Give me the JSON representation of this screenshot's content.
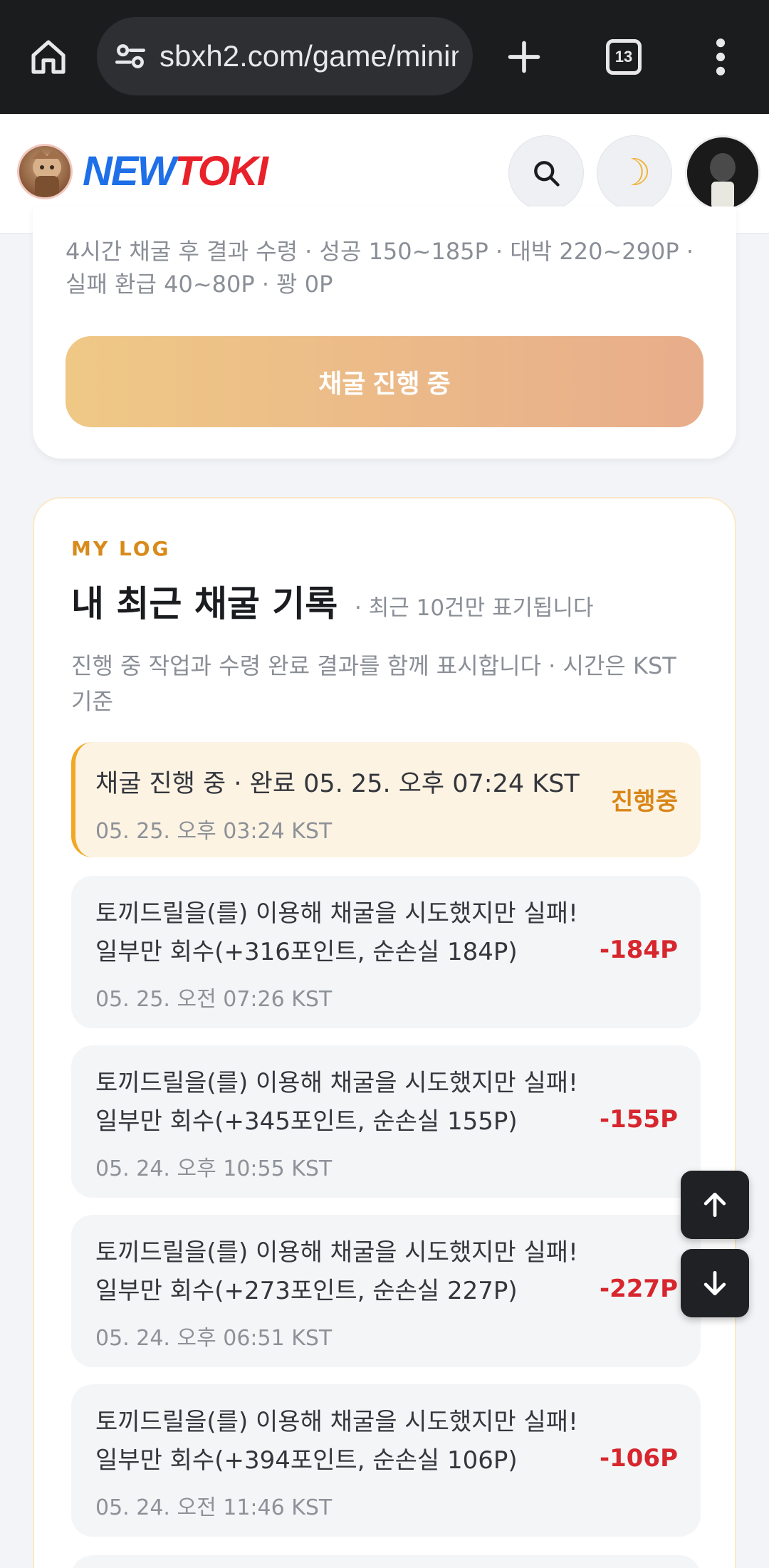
{
  "browser": {
    "url": "sbxh2.com/game/mining",
    "tab_count": "13",
    "icons": [
      "home-icon",
      "site-settings-icon",
      "plus-icon",
      "tabs-icon",
      "more-vert-icon"
    ]
  },
  "header": {
    "logo_part1": "NEW",
    "logo_part2": "TOKI",
    "colors": {
      "logo_blue": "#1e6fe8",
      "logo_red": "#e8212a"
    }
  },
  "top_card": {
    "description": "4시간 채굴 후 결과 수령 · 성공 150~185P · 대박 220~290P · 실패 환급 40~80P · 꽝 0P",
    "button_label": "채굴 진행 중"
  },
  "log": {
    "eyebrow": "MY LOG",
    "title": "내 최근 채굴 기록",
    "subnote": "· 최근 10건만 표기됩니다",
    "description": "진행 중 작업과 수령 완료 결과를 함께 표시합니다 · 시간은 KST 기준",
    "entries": [
      {
        "title": "채굴 진행 중 · 완료 05. 25. 오후 07:24 KST",
        "time": "05. 25. 오후 03:24 KST",
        "value": "진행중",
        "status": "active"
      },
      {
        "title": "토끼드릴을(를) 이용해 채굴을 시도했지만 실패! 일부만 회수(+316포인트, 순손실 184P)",
        "time": "05. 25. 오전 07:26 KST",
        "value": "-184P",
        "status": "loss"
      },
      {
        "title": "토끼드릴을(를) 이용해 채굴을 시도했지만 실패! 일부만 회수(+345포인트, 순손실 155P)",
        "time": "05. 24. 오후 10:55 KST",
        "value": "-155P",
        "status": "loss"
      },
      {
        "title": "토끼드릴을(를) 이용해 채굴을 시도했지만 실패! 일부만 회수(+273포인트, 순손실 227P)",
        "time": "05. 24. 오후 06:51 KST",
        "value": "-227P",
        "status": "loss"
      },
      {
        "title": "토끼드릴을(를) 이용해 채굴을 시도했지만 실패! 일부만 회수(+394포인트, 순손실 106P)",
        "time": "05. 24. 오전 11:46 KST",
        "value": "-106P",
        "status": "loss"
      }
    ]
  },
  "fab": {
    "up_icon": "arrow-up-icon",
    "down_icon": "arrow-down-icon"
  },
  "colors": {
    "accent_orange": "#d88a1a",
    "loss_red": "#d7262d",
    "active_bg": "#fdf3e3"
  }
}
